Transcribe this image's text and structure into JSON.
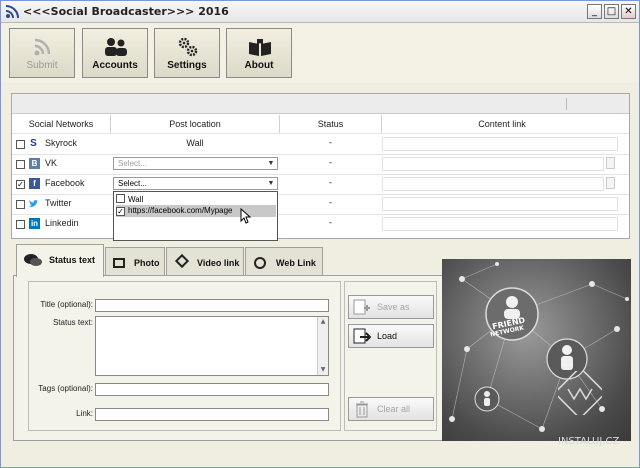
{
  "window": {
    "title": "<<<Social Broadcaster>>> 2016",
    "minimize": "_",
    "maximize": "□",
    "close": "✕"
  },
  "toolbar": {
    "submit": "Submit",
    "accounts": "Accounts",
    "settings": "Settings",
    "about": "About"
  },
  "table": {
    "headers": [
      "Social Networks",
      "Post location",
      "Status",
      "Content link"
    ],
    "rows": [
      {
        "checked": false,
        "network": "Skyrock",
        "icon": "skyrock-icon",
        "icon_color": "#1a3a8a",
        "location": "Wall",
        "location_type": "text",
        "status": "-"
      },
      {
        "checked": false,
        "network": "VK",
        "icon": "vk-icon",
        "icon_color": "#5b7fa6",
        "location": "Select...",
        "location_type": "select-dim",
        "status": "-"
      },
      {
        "checked": true,
        "network": "Facebook",
        "icon": "facebook-icon",
        "icon_color": "#3b5998",
        "location": "Select...",
        "location_type": "select",
        "status": "-"
      },
      {
        "checked": false,
        "network": "Twitter",
        "icon": "twitter-icon",
        "icon_color": "#1da1f2",
        "location": "",
        "location_type": "none",
        "status": "-"
      },
      {
        "checked": false,
        "network": "Linkedin",
        "icon": "linkedin-icon",
        "icon_color": "#0077b5",
        "location": "",
        "location_type": "none",
        "status": "-"
      }
    ],
    "dropdown": [
      {
        "checked": false,
        "label": "Wall"
      },
      {
        "checked": true,
        "label": "https://facebook.com/Mypage"
      }
    ]
  },
  "tabs": [
    "Status text",
    "Photo",
    "Video link",
    "Web Link"
  ],
  "form": {
    "title_label": "Title (optional):",
    "status_label": "Status text:",
    "tags_label": "Tags (optional):",
    "link_label": "Link:",
    "save_as": "Save as",
    "load": "Load",
    "clear_all": "Clear all"
  },
  "image_panel": {
    "badge_line1": "FRIEND",
    "badge_line2": "NETWORK",
    "watermark": "INSTALUJ.CZ"
  },
  "colors": {
    "accent": "#7a96df",
    "panel_bg": "#f0eee0"
  }
}
